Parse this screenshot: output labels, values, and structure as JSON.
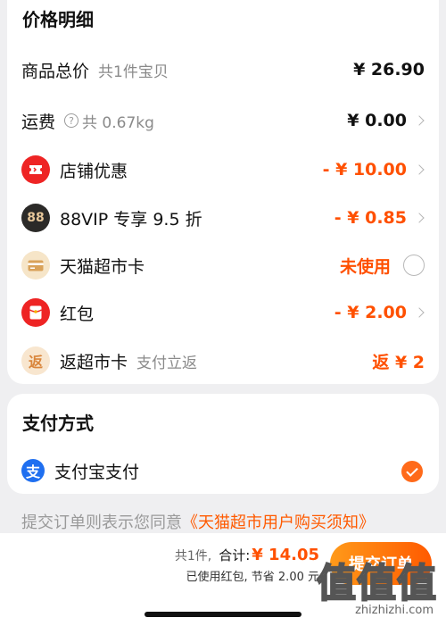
{
  "price_section": {
    "title": "价格明细",
    "goods_total": {
      "label": "商品总价",
      "sub": "共1件宝贝",
      "value": "¥ 26.90"
    },
    "shipping": {
      "label": "运费",
      "help_glyph": "?",
      "sub": "共 0.67kg",
      "value": "¥ 0.00"
    },
    "shop_discount": {
      "label": "店铺优惠",
      "value": "- ¥ 10.00",
      "icon": "ticket-icon"
    },
    "vip": {
      "label": "88VIP 专享 9.5 折",
      "value": "- ¥ 0.85",
      "badge": "88"
    },
    "tmall_card": {
      "label": "天猫超市卡",
      "value": "未使用",
      "icon": "card-icon"
    },
    "red_packet": {
      "label": "红包",
      "value": "- ¥ 2.00",
      "icon": "red-packet-icon"
    },
    "rebate": {
      "label": "返超市卡",
      "sub": "支付立返",
      "value": "返 ¥ 2",
      "badge": "返"
    }
  },
  "payment_section": {
    "title": "支付方式",
    "method": {
      "label": "支付宝支付",
      "badge": "支"
    }
  },
  "agreement": {
    "text": "提交订单则表示您同意",
    "link": "《天猫超市用户购买须知》"
  },
  "footer": {
    "count": "共1件,",
    "total_label": "合计:",
    "total": "¥ 14.05",
    "note": "已使用红包, 节省 2.00 元",
    "submit": "提交订单"
  },
  "watermark": {
    "text": "值值值",
    "url": "zhizhizhi.com"
  },
  "colors": {
    "accent": "#ff5000",
    "alipay": "#1f6ff0",
    "red": "#ee2424"
  }
}
